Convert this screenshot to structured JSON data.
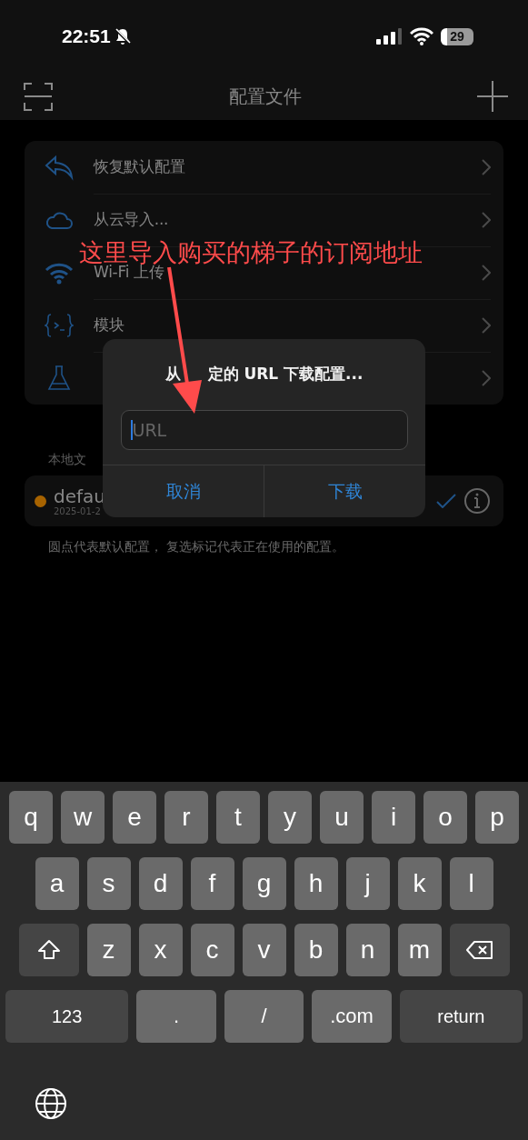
{
  "status_bar": {
    "time": "22:51",
    "battery": "29"
  },
  "nav": {
    "title": "配置文件"
  },
  "menu": [
    {
      "kind": "undo",
      "label": "恢复默认配置"
    },
    {
      "kind": "cloud",
      "label": "从云导入..."
    },
    {
      "kind": "wifi",
      "label": "Wi-Fi 上传"
    },
    {
      "kind": "module",
      "label": "模块"
    },
    {
      "kind": "flask"
    }
  ],
  "local": {
    "label": "本地文",
    "files": [
      {
        "name": "defau",
        "date": "2025-01-2",
        "default": true,
        "in_use": true
      }
    ]
  },
  "footnote": "圆点代表默认配置， 复选标记代表正在使用的配置。",
  "dialog": {
    "title_start": "从",
    "title": "定的 URL 下载配置...",
    "placeholder": "URL",
    "buttons": [
      "取消",
      "下载"
    ]
  },
  "annotation": "这里导入购买的梯子的订阅地址",
  "keyboard": [
    [
      {
        "kind": "key",
        "label": "q"
      },
      {
        "kind": "key",
        "label": "w"
      },
      {
        "kind": "key",
        "label": "e"
      },
      {
        "kind": "key",
        "label": "r"
      },
      {
        "kind": "key",
        "label": "t"
      },
      {
        "kind": "key",
        "label": "y"
      },
      {
        "kind": "key",
        "label": "u"
      },
      {
        "kind": "key",
        "label": "i"
      },
      {
        "kind": "key",
        "label": "o"
      },
      {
        "kind": "key",
        "label": "p"
      }
    ],
    [
      {
        "kind": "key",
        "label": "a"
      },
      {
        "kind": "key",
        "label": "s"
      },
      {
        "kind": "key",
        "label": "d"
      },
      {
        "kind": "key",
        "label": "f"
      },
      {
        "kind": "key",
        "label": "g"
      },
      {
        "kind": "key",
        "label": "h"
      },
      {
        "kind": "key",
        "label": "j"
      },
      {
        "kind": "key",
        "label": "k"
      },
      {
        "kind": "key",
        "label": "l"
      }
    ],
    [
      {
        "kind": "shift"
      },
      {
        "kind": "key",
        "label": "z"
      },
      {
        "kind": "key",
        "label": "x"
      },
      {
        "kind": "key",
        "label": "c"
      },
      {
        "kind": "key",
        "label": "v"
      },
      {
        "kind": "key",
        "label": "b"
      },
      {
        "kind": "key",
        "label": "n"
      },
      {
        "kind": "key",
        "label": "m"
      },
      {
        "kind": "delete"
      }
    ],
    [
      {
        "kind": "func",
        "label": "123"
      },
      {
        "kind": "key",
        "label": "."
      },
      {
        "kind": "key",
        "label": "/"
      },
      {
        "kind": "key",
        "label": ".com"
      },
      {
        "kind": "func",
        "label": "return"
      }
    ]
  ]
}
